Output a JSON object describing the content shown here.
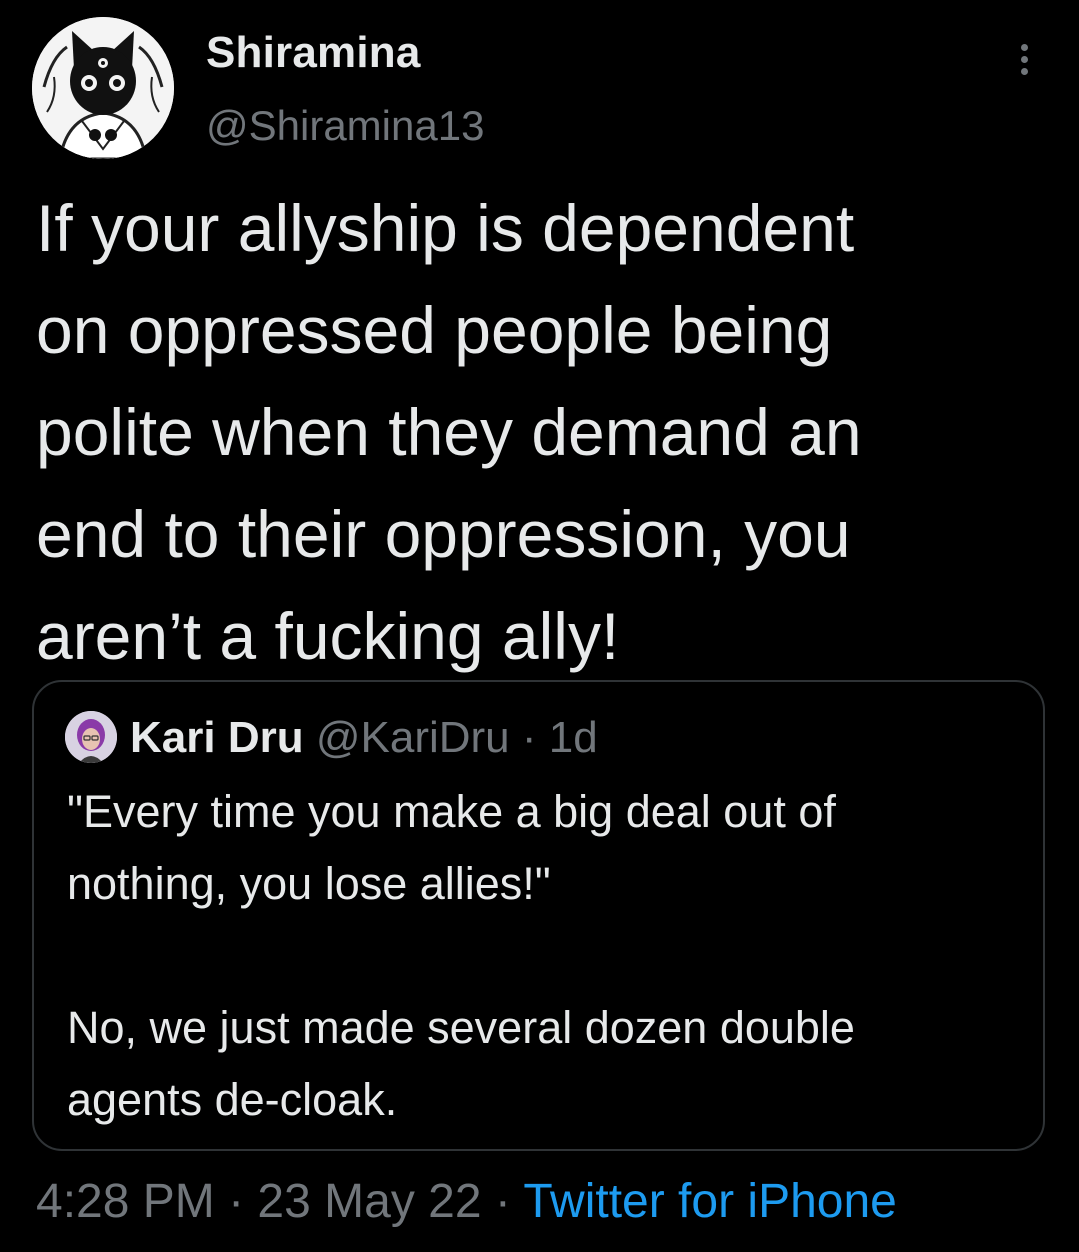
{
  "author": {
    "display_name": "Shiramina",
    "handle": "@Shiramina13",
    "avatar_icon": "black-cat-avatar-icon"
  },
  "more_icon": "more-vertical-icon",
  "tweet": {
    "text": "If your allyship is dependent\non oppressed people being\npolite when they demand an\nend to their oppression, you\naren’t a fucking ally!"
  },
  "quoted_tweet": {
    "avatar_icon": "profile-photo-icon",
    "display_name": "Kari Dru",
    "handle": "@KariDru",
    "separator": " · ",
    "time": "1d",
    "text": "\"Every time you make a big deal out of\nnothing, you lose allies!\"\n\nNo, we just made several dozen double\nagents de-cloak."
  },
  "meta": {
    "time": "4:28 PM",
    "separator": " · ",
    "date": "23 May 22",
    "source": "Twitter for iPhone"
  },
  "colors": {
    "background": "#000000",
    "text": "#e7e9ea",
    "secondary": "#71767b",
    "link": "#1d9bf0",
    "border": "#2f3336"
  }
}
